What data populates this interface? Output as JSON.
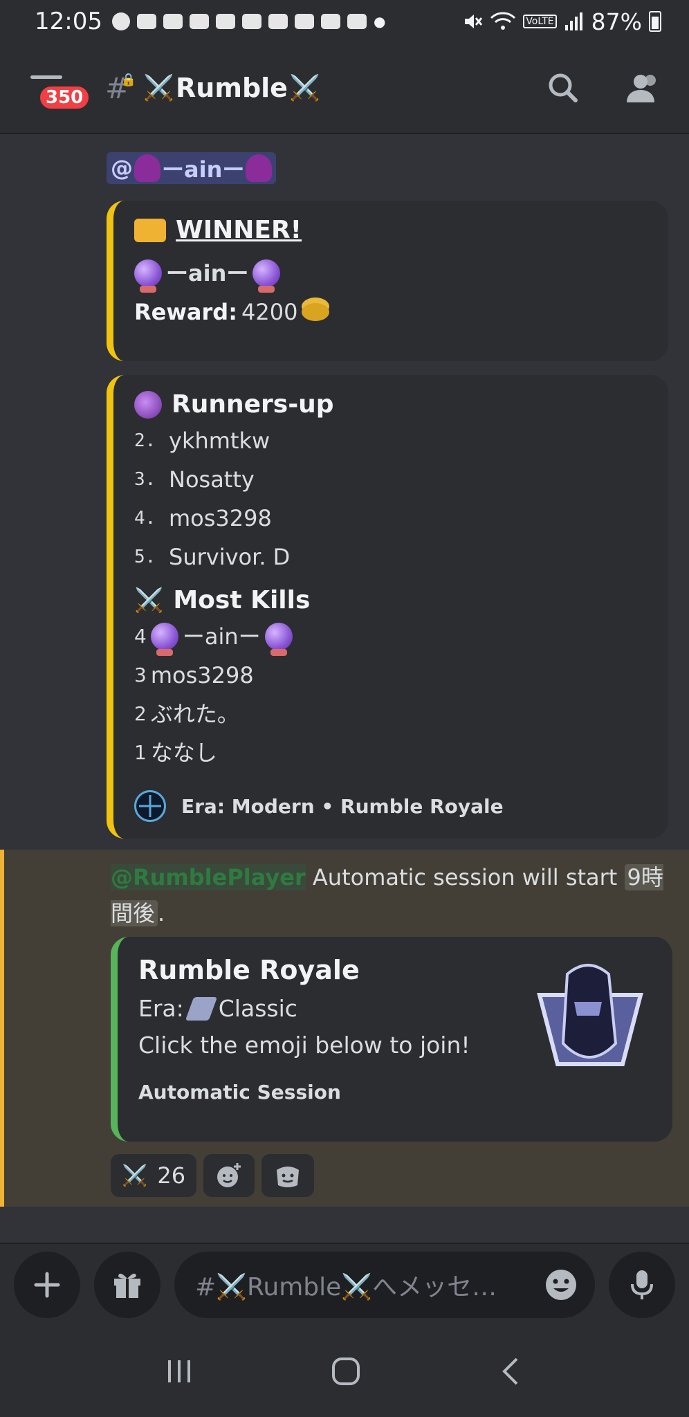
{
  "status_bar": {
    "time": "12:05",
    "battery": "87%",
    "volte": "VoLTE"
  },
  "header": {
    "unread_badge": "350",
    "channel_name": "Rumble",
    "channel_emoji": "⚔️"
  },
  "mention_pill": {
    "at": "@",
    "name": "ーainー"
  },
  "winner_embed": {
    "title": "WINNER!",
    "winner_name": "ーainー",
    "reward_label": "Reward:",
    "reward_value": "4200"
  },
  "results_embed": {
    "runners_up_title": "Runners-up",
    "runners_up": [
      {
        "rank": "2.",
        "name": "ykhmtkw"
      },
      {
        "rank": "3.",
        "name": "Nosatty"
      },
      {
        "rank": "4.",
        "name": "mos3298"
      },
      {
        "rank": "5.",
        "name": "Survivor. D"
      }
    ],
    "most_kills_title": "Most Kills",
    "most_kills": [
      {
        "count": "4",
        "name": "ーainー"
      },
      {
        "count": "3",
        "name": "mos3298"
      },
      {
        "count": "2",
        "name": "ぶれた。"
      },
      {
        "count": "1",
        "name": "ななし"
      }
    ],
    "footer": "Era: Modern • Rumble Royale"
  },
  "session_message": {
    "mention": "@RumblePlayer",
    "text_before": " Automatic session will start ",
    "time_chip": "9時間後",
    "text_after": "."
  },
  "session_embed": {
    "title": "Rumble Royale",
    "era_label": "Era:",
    "era_value": "Classic",
    "instruction": "Click the emoji below to join!",
    "footer": "Automatic Session"
  },
  "reactions": {
    "swords_count": "26"
  },
  "composer": {
    "placeholder": "#⚔️Rumble⚔️へメッセ…"
  },
  "colors": {
    "winner_bar": "#f0c30f",
    "session_bar": "#57b45a",
    "highlight_bg": "#433f36",
    "badge": "#f23f43"
  }
}
